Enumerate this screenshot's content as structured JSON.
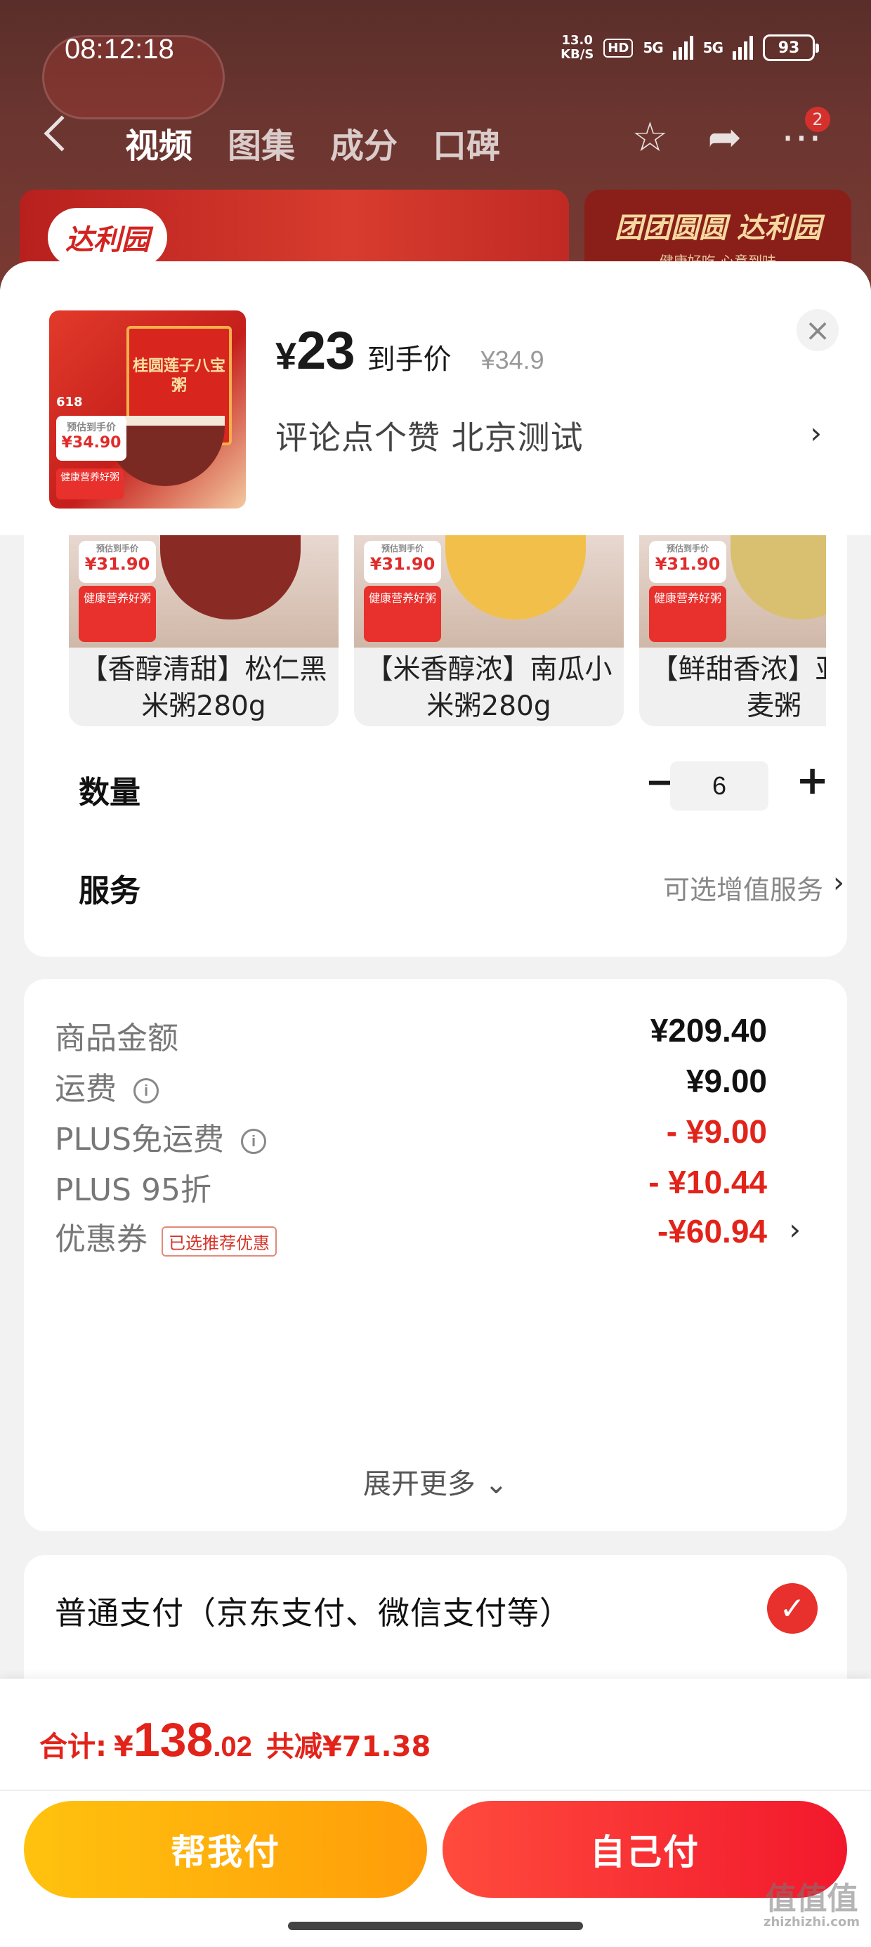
{
  "status_bar": {
    "time": "08:12:18",
    "speed_value": "13.0",
    "speed_unit": "KB/S",
    "hd": "HD",
    "net1": "5G",
    "net2": "5G",
    "battery": "93"
  },
  "nav": {
    "tabs": [
      "视频",
      "图集",
      "成分",
      "口碑"
    ],
    "badge": "2",
    "icons": [
      "back-icon",
      "star-icon",
      "share-icon",
      "more-icon"
    ]
  },
  "banner": {
    "left_logo": "达利园",
    "right_title": "团团圆圆 达利园",
    "right_sub": "健康好吃 心意到味"
  },
  "product": {
    "currency": "¥",
    "price": "23",
    "price_label": "到手价",
    "original_price": "¥34.9",
    "spec": "评论点个赞  北京测试",
    "thumb_box_text": "桂圆莲子八宝粥",
    "thumb_618": "618",
    "thumb_price_label": "预估到手价",
    "thumb_price": "¥34.90",
    "thumb_tag": "健康营养好粥"
  },
  "variants": [
    {
      "name": "【香醇清甜】松仁黑米粥280g",
      "price_label": "预估到手价",
      "price": "¥31.90",
      "tag": "健康营养好粥",
      "bowl_color": "#8a2a24"
    },
    {
      "name": "【米香醇浓】南瓜小米粥280g",
      "price_label": "预估到手价",
      "price": "¥31.90",
      "tag": "健康营养好粥",
      "bowl_color": "#f2c04a"
    },
    {
      "name": "【鲜甜香浓】亚籽燕麦粥",
      "price_label": "预估到手价",
      "price": "¥31.90",
      "tag": "健康营养好粥",
      "bowl_color": "#d8c070"
    }
  ],
  "quantity": {
    "label": "数量",
    "value": "6",
    "minus": "−",
    "plus": "+"
  },
  "service": {
    "label": "服务",
    "value": "可选增值服务"
  },
  "summary": {
    "lines": [
      {
        "label": "商品金额",
        "value": "¥209.40"
      },
      {
        "label": "运费",
        "value": "¥9.00"
      },
      {
        "label": "PLUS免运费",
        "value": "- ¥9.00"
      },
      {
        "label": "PLUS 95折",
        "value": "- ¥10.44"
      },
      {
        "label": "优惠券",
        "value": "-¥60.94",
        "tag": "已选推荐优惠"
      }
    ],
    "expand": "展开更多"
  },
  "payment": {
    "label": "普通支付（京东支付、微信支付等）"
  },
  "total": {
    "label": "合计:",
    "currency": "¥",
    "integer": "138",
    "decimal": ".02",
    "saved": "共减¥71.38"
  },
  "buttons": {
    "help": "帮我付",
    "self": "自己付"
  },
  "watermark": {
    "text": "值值值",
    "sub": "zhizhizhi.com"
  },
  "colors": {
    "accent": "#e2231a",
    "help_button": "#ffb30c",
    "self_button": "#f2252f"
  }
}
